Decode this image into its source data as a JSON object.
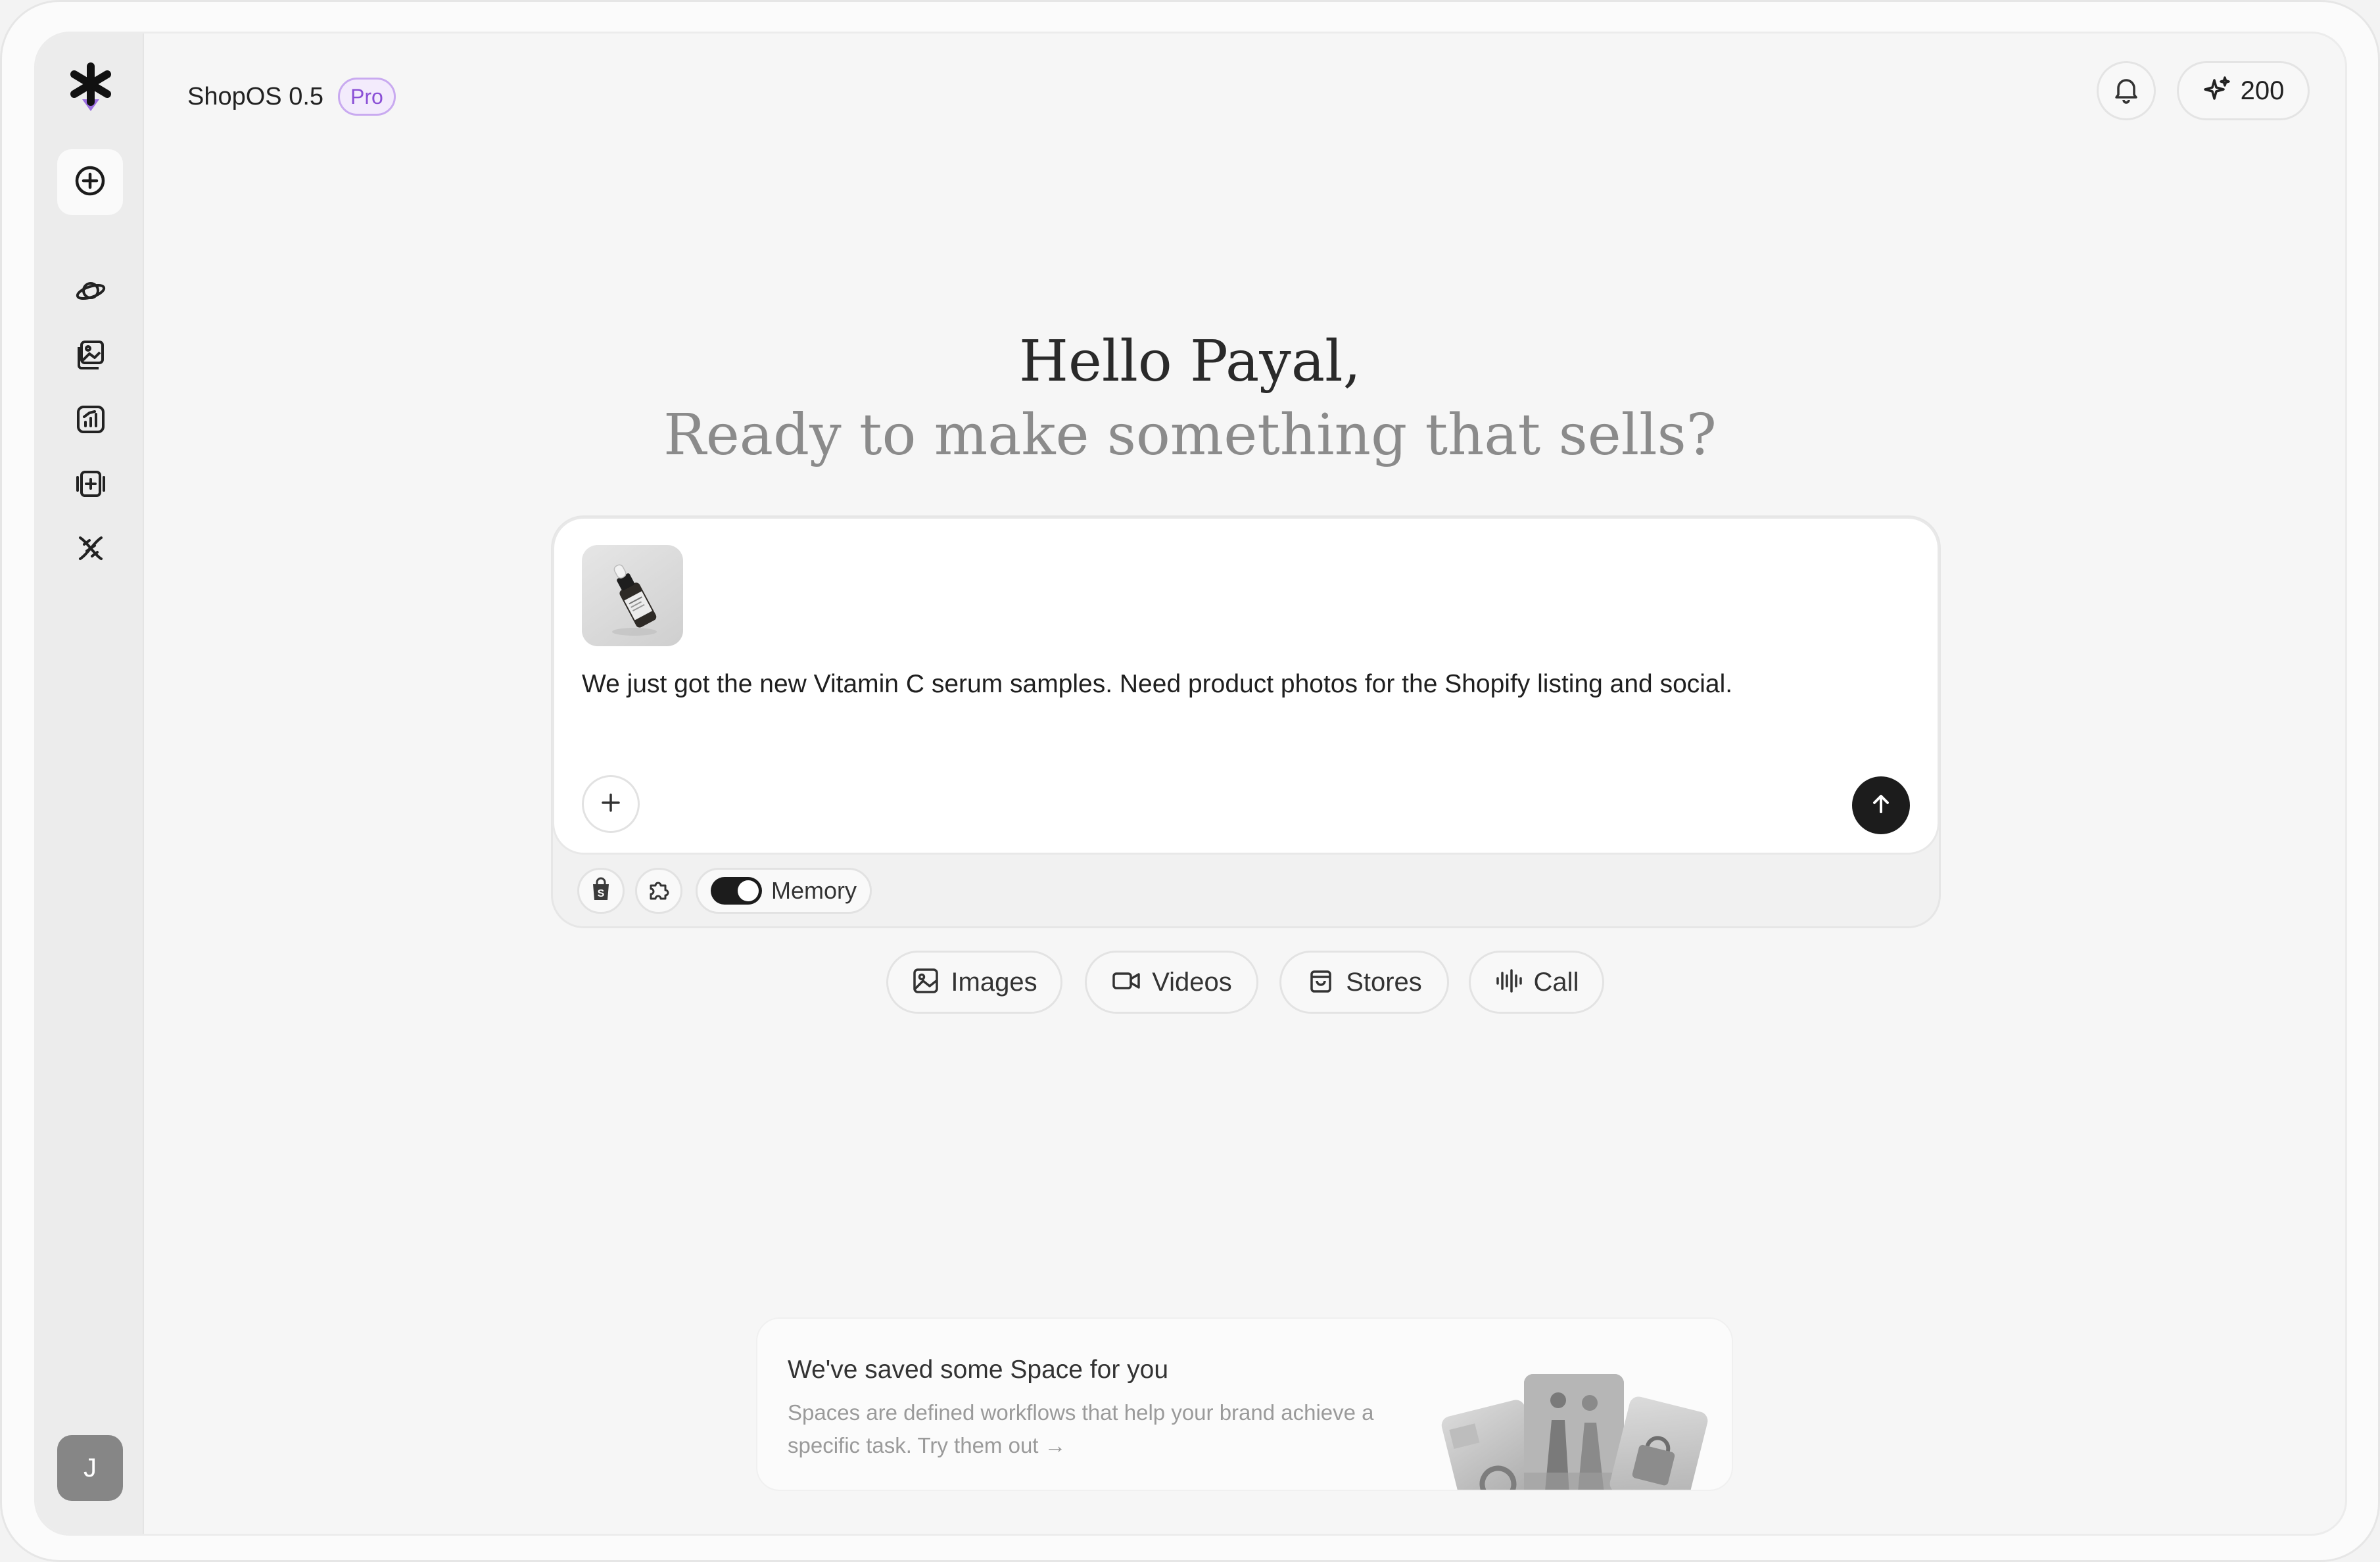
{
  "header": {
    "app_name": "ShopOS 0.5",
    "plan_badge": "Pro",
    "credits": "200"
  },
  "sidebar": {
    "items": [
      {
        "name": "new-chat",
        "icon": "plus-circle-icon"
      },
      {
        "name": "planet",
        "icon": "planet-icon"
      },
      {
        "name": "gallery",
        "icon": "images-icon"
      },
      {
        "name": "analytics",
        "icon": "chart-icon"
      },
      {
        "name": "media",
        "icon": "media-plus-icon"
      },
      {
        "name": "dna",
        "icon": "dna-icon"
      }
    ],
    "user_initial": "J"
  },
  "greeting": {
    "hello": "Hello Payal,",
    "subline": "Ready to make something that sells?"
  },
  "composer": {
    "prompt": "We just got the new Vitamin C serum samples. Need product photos for the Shopify listing and social.",
    "memory_label": "Memory",
    "memory_enabled": true
  },
  "quick_actions": [
    {
      "label": "Images",
      "icon": "image-icon"
    },
    {
      "label": "Videos",
      "icon": "video-icon"
    },
    {
      "label": "Stores",
      "icon": "shopping-bag-icon"
    },
    {
      "label": "Call",
      "icon": "audio-wave-icon"
    }
  ],
  "spaces": {
    "title": "We've saved some Space for you",
    "description": "Spaces are defined workflows that help your brand achieve a specific task. Try them out →"
  },
  "colors": {
    "accent_purple": "#8a4fd6",
    "send_button": "#1c1c1c"
  }
}
